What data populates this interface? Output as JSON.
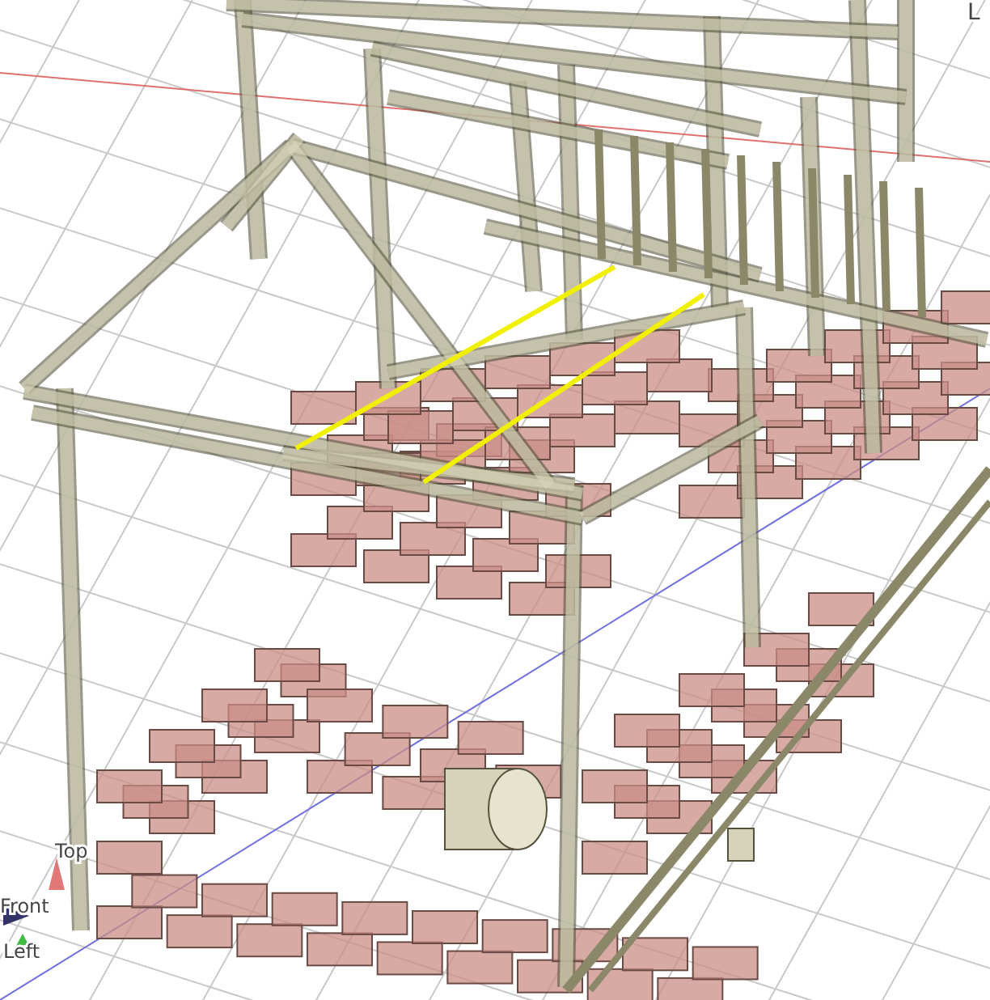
{
  "viewport": {
    "corner_label": "L"
  },
  "axis_triad": {
    "labels": [
      "Top",
      "Front",
      "Left"
    ]
  }
}
